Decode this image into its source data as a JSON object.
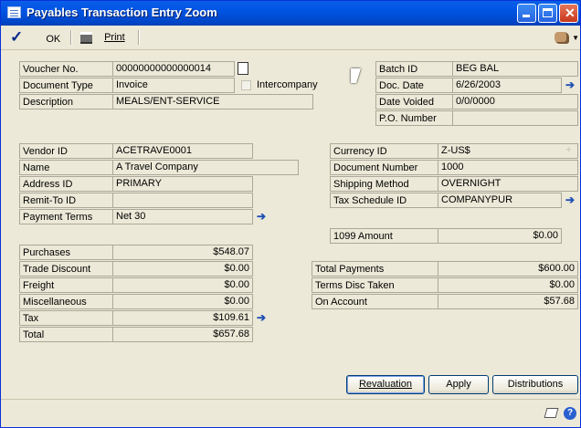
{
  "window": {
    "title": "Payables Transaction Entry Zoom"
  },
  "toolbar": {
    "ok_label": "OK",
    "print_label": "Print"
  },
  "header": {
    "voucher_no_label": "Voucher No.",
    "voucher_no": "00000000000000014",
    "document_type_label": "Document Type",
    "document_type": "Invoice",
    "intercompany_label": "Intercompany",
    "description_label": "Description",
    "description": "MEALS/ENT-SERVICE",
    "batch_id_label": "Batch ID",
    "batch_id": "BEG BAL",
    "doc_date_label": "Doc. Date",
    "doc_date": "6/26/2003",
    "date_voided_label": "Date Voided",
    "date_voided": "0/0/0000",
    "po_number_label": "P.O. Number",
    "po_number": ""
  },
  "vendor": {
    "vendor_id_label": "Vendor ID",
    "vendor_id": "ACETRAVE0001",
    "name_label": "Name",
    "name": "A Travel Company",
    "address_id_label": "Address ID",
    "address_id": "PRIMARY",
    "remit_to_label": "Remit-To ID",
    "remit_to": "",
    "payment_terms_label": "Payment Terms",
    "payment_terms": "Net 30"
  },
  "currency": {
    "currency_id_label": "Currency ID",
    "currency_id": "Z-US$",
    "document_number_label": "Document Number",
    "document_number": "1000",
    "shipping_method_label": "Shipping Method",
    "shipping_method": "OVERNIGHT",
    "tax_schedule_label": "Tax Schedule ID",
    "tax_schedule": "COMPANYPUR",
    "amount_1099_label": "1099 Amount",
    "amount_1099": "$0.00"
  },
  "amounts": {
    "purchases_label": "Purchases",
    "purchases": "$548.07",
    "trade_discount_label": "Trade Discount",
    "trade_discount": "$0.00",
    "freight_label": "Freight",
    "freight": "$0.00",
    "misc_label": "Miscellaneous",
    "misc": "$0.00",
    "tax_label": "Tax",
    "tax": "$109.61",
    "total_label": "Total",
    "total": "$657.68"
  },
  "payments": {
    "total_payments_label": "Total Payments",
    "total_payments": "$600.00",
    "terms_disc_label": "Terms Disc Taken",
    "terms_disc": "$0.00",
    "on_account_label": "On Account",
    "on_account": "$57.68"
  },
  "buttons": {
    "revaluation": "Revaluation",
    "apply": "Apply",
    "distributions": "Distributions"
  }
}
